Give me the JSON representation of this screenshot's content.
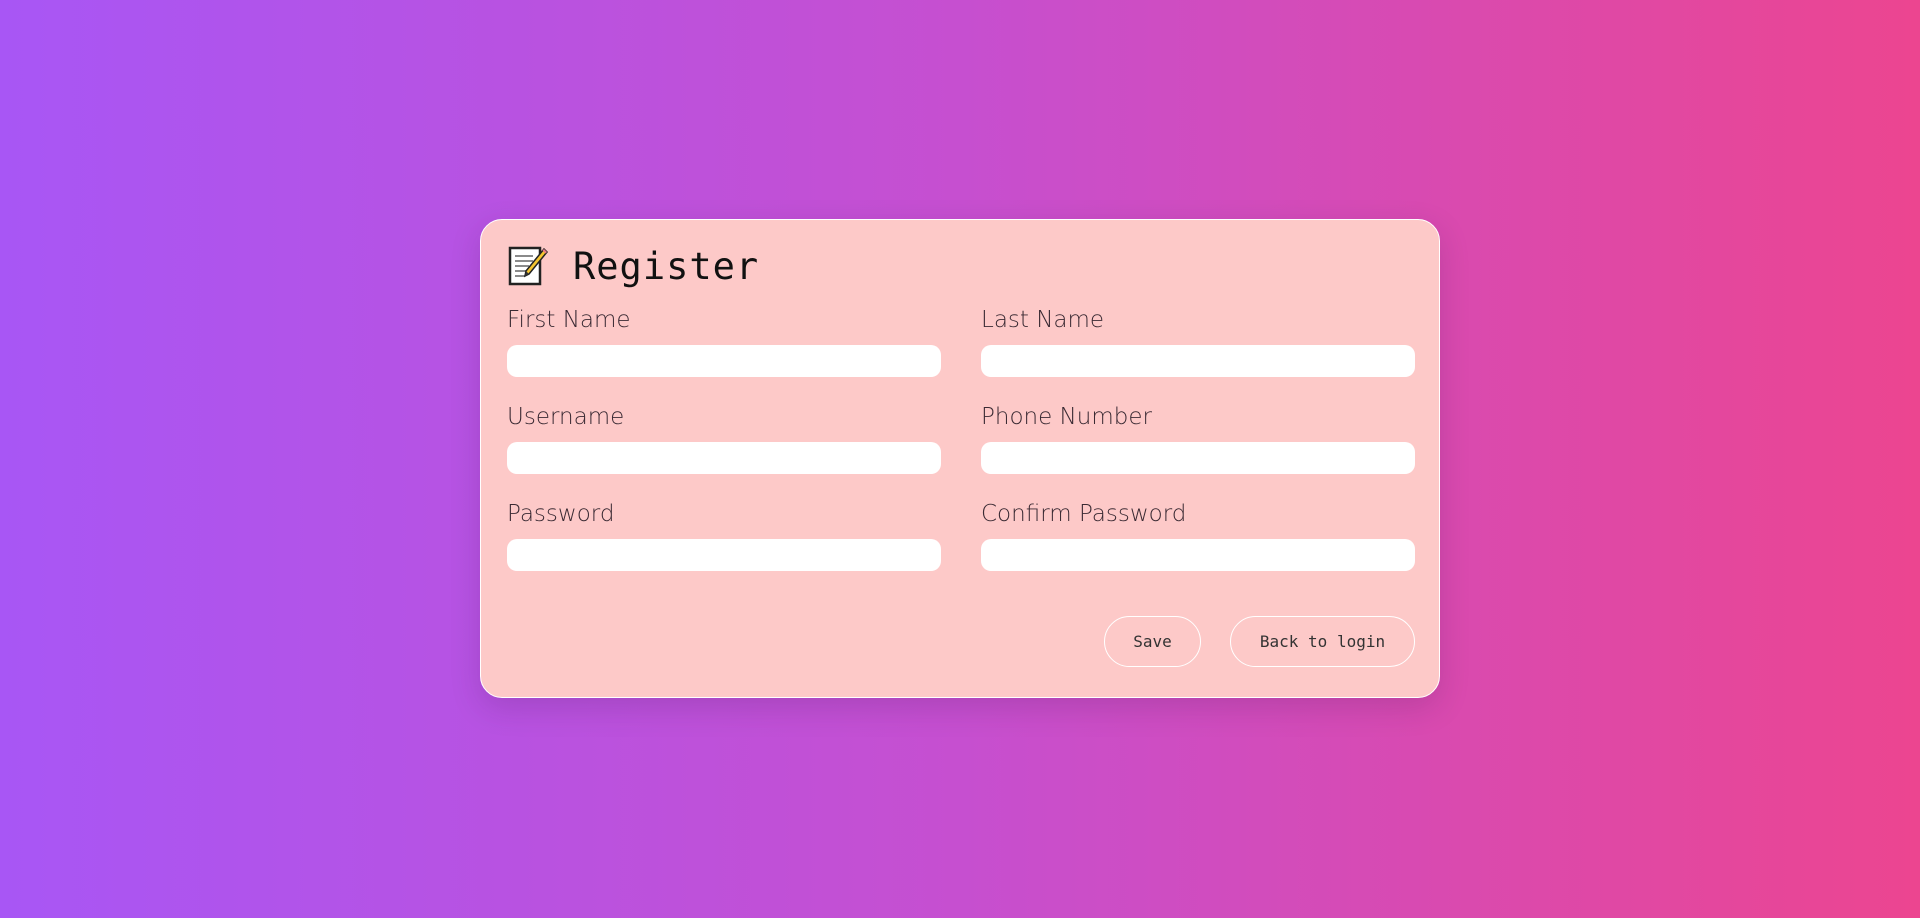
{
  "form": {
    "title": "Register",
    "icon": "memo-icon",
    "fields": {
      "first_name": {
        "label": "First Name",
        "value": "",
        "placeholder": ""
      },
      "last_name": {
        "label": "Last Name",
        "value": "",
        "placeholder": ""
      },
      "username": {
        "label": "Username",
        "value": "",
        "placeholder": ""
      },
      "phone_number": {
        "label": "Phone Number",
        "value": "",
        "placeholder": ""
      },
      "password": {
        "label": "Password",
        "value": "",
        "placeholder": ""
      },
      "confirm_password": {
        "label": "Confirm Password",
        "value": "",
        "placeholder": ""
      }
    },
    "buttons": {
      "save": "Save",
      "back": "Back to login"
    }
  },
  "colors": {
    "background_start": "#a856f5",
    "background_end": "#ec4590",
    "card": "#fdc9c8",
    "input": "#ffffff",
    "card_border": "#ffffff"
  }
}
